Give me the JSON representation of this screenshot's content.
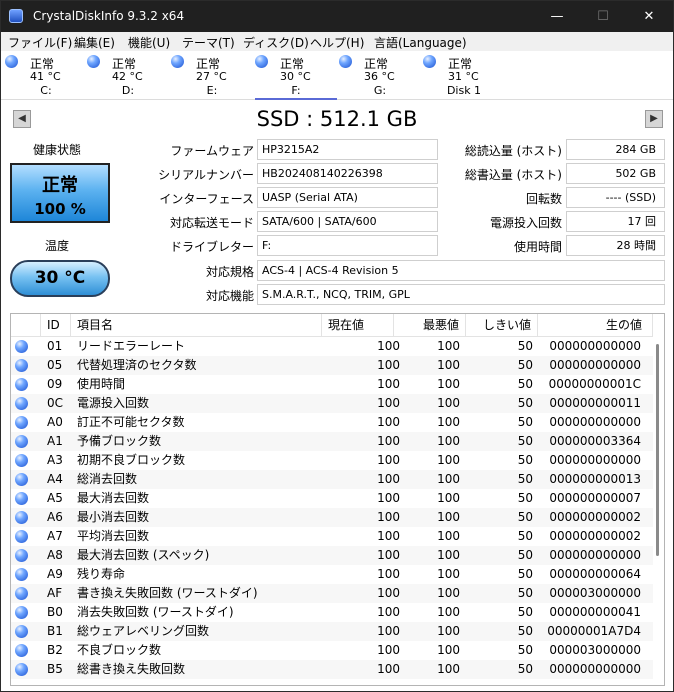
{
  "window": {
    "title": "CrystalDiskInfo 9.3.2 x64",
    "min": "—",
    "max": "☐",
    "close": "✕"
  },
  "menu": [
    "ファイル(F)",
    "編集(E)",
    "機能(U)",
    "テーマ(T)",
    "ディスク(D)",
    "ヘルプ(H)",
    "言語(Language)"
  ],
  "disks": [
    {
      "status": "正常",
      "temp": "41 °C",
      "drive": "C:"
    },
    {
      "status": "正常",
      "temp": "42 °C",
      "drive": "D:"
    },
    {
      "status": "正常",
      "temp": "27 °C",
      "drive": "E:"
    },
    {
      "status": "正常",
      "temp": "30 °C",
      "drive": "F:"
    },
    {
      "status": "正常",
      "temp": "36 °C",
      "drive": "G:"
    },
    {
      "status": "正常",
      "temp": "31 °C",
      "drive": "Disk 1"
    }
  ],
  "active_disk": 3,
  "nav": {
    "prev": "◀",
    "next": "▶"
  },
  "model": "SSD : 512.1 GB",
  "health": {
    "label": "健康状態",
    "status": "正常",
    "percent": "100 %"
  },
  "temperature": {
    "label": "温度",
    "value": "30 °C"
  },
  "info_left": [
    {
      "label": "ファームウェア",
      "value": "HP3215A2"
    },
    {
      "label": "シリアルナンバー",
      "value": "HB202408140226398"
    },
    {
      "label": "インターフェース",
      "value": "UASP (Serial ATA)"
    },
    {
      "label": "対応転送モード",
      "value": "SATA/600 | SATA/600"
    },
    {
      "label": "ドライブレター",
      "value": "F:"
    }
  ],
  "info_right": [
    {
      "label": "総読込量 (ホスト)",
      "value": "284 GB"
    },
    {
      "label": "総書込量 (ホスト)",
      "value": "502 GB"
    },
    {
      "label": "回転数",
      "value": "---- (SSD)"
    },
    {
      "label": "電源投入回数",
      "value": "17 回"
    },
    {
      "label": "使用時間",
      "value": "28 時間"
    }
  ],
  "info_wide": [
    {
      "label": "対応規格",
      "value": "ACS-4 | ACS-4 Revision 5"
    },
    {
      "label": "対応機能",
      "value": "S.M.A.R.T., NCQ, TRIM, GPL"
    }
  ],
  "smart": {
    "headers": {
      "id": "ID",
      "name": "項目名",
      "current": "現在値",
      "worst": "最悪値",
      "threshold": "しきい値",
      "raw": "生の値"
    },
    "rows": [
      {
        "id": "01",
        "name": "リードエラーレート",
        "current": "100",
        "worst": "100",
        "threshold": "50",
        "raw": "000000000000"
      },
      {
        "id": "05",
        "name": "代替処理済のセクタ数",
        "current": "100",
        "worst": "100",
        "threshold": "50",
        "raw": "000000000000"
      },
      {
        "id": "09",
        "name": "使用時間",
        "current": "100",
        "worst": "100",
        "threshold": "50",
        "raw": "00000000001C"
      },
      {
        "id": "0C",
        "name": "電源投入回数",
        "current": "100",
        "worst": "100",
        "threshold": "50",
        "raw": "000000000011"
      },
      {
        "id": "A0",
        "name": "訂正不可能セクタ数",
        "current": "100",
        "worst": "100",
        "threshold": "50",
        "raw": "000000000000"
      },
      {
        "id": "A1",
        "name": "予備ブロック数",
        "current": "100",
        "worst": "100",
        "threshold": "50",
        "raw": "000000003364"
      },
      {
        "id": "A3",
        "name": "初期不良ブロック数",
        "current": "100",
        "worst": "100",
        "threshold": "50",
        "raw": "000000000000"
      },
      {
        "id": "A4",
        "name": "総消去回数",
        "current": "100",
        "worst": "100",
        "threshold": "50",
        "raw": "000000000013"
      },
      {
        "id": "A5",
        "name": "最大消去回数",
        "current": "100",
        "worst": "100",
        "threshold": "50",
        "raw": "000000000007"
      },
      {
        "id": "A6",
        "name": "最小消去回数",
        "current": "100",
        "worst": "100",
        "threshold": "50",
        "raw": "000000000002"
      },
      {
        "id": "A7",
        "name": "平均消去回数",
        "current": "100",
        "worst": "100",
        "threshold": "50",
        "raw": "000000000002"
      },
      {
        "id": "A8",
        "name": "最大消去回数 (スペック)",
        "current": "100",
        "worst": "100",
        "threshold": "50",
        "raw": "000000000000"
      },
      {
        "id": "A9",
        "name": "残り寿命",
        "current": "100",
        "worst": "100",
        "threshold": "50",
        "raw": "000000000064"
      },
      {
        "id": "AF",
        "name": "書き換え失敗回数 (ワーストダイ)",
        "current": "100",
        "worst": "100",
        "threshold": "50",
        "raw": "000003000000"
      },
      {
        "id": "B0",
        "name": "消去失敗回数 (ワーストダイ)",
        "current": "100",
        "worst": "100",
        "threshold": "50",
        "raw": "000000000041"
      },
      {
        "id": "B1",
        "name": "総ウェアレベリング回数",
        "current": "100",
        "worst": "100",
        "threshold": "50",
        "raw": "00000001A7D4"
      },
      {
        "id": "B2",
        "name": "不良ブロック数",
        "current": "100",
        "worst": "100",
        "threshold": "50",
        "raw": "000003000000"
      },
      {
        "id": "B5",
        "name": "総書き換え失敗回数",
        "current": "100",
        "worst": "100",
        "threshold": "50",
        "raw": "000000000000"
      }
    ]
  }
}
